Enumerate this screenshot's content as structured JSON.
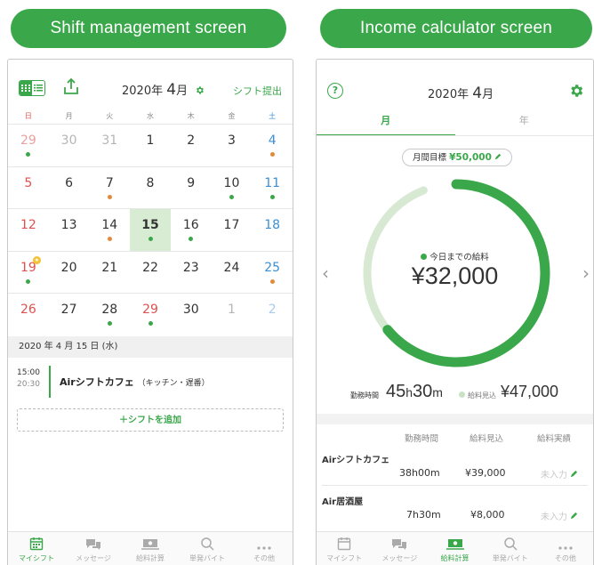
{
  "pills": {
    "left": "Shift management screen",
    "right": "Income calculator screen"
  },
  "shift_screen": {
    "year": "2020",
    "year_suffix": "年",
    "month": "4",
    "month_suffix": "月",
    "submit_label": "シフト提出",
    "weekdays": [
      "日",
      "月",
      "火",
      "水",
      "木",
      "金",
      "土"
    ],
    "weeks": [
      [
        {
          "d": "29",
          "t": "sun other",
          "dot": "g"
        },
        {
          "d": "30",
          "t": "other"
        },
        {
          "d": "31",
          "t": "other"
        },
        {
          "d": "1"
        },
        {
          "d": "2"
        },
        {
          "d": "3"
        },
        {
          "d": "4",
          "t": "sat",
          "dot": "o"
        }
      ],
      [
        {
          "d": "5",
          "t": "sun"
        },
        {
          "d": "6"
        },
        {
          "d": "7",
          "dot": "o"
        },
        {
          "d": "8"
        },
        {
          "d": "9"
        },
        {
          "d": "10",
          "dot": "g"
        },
        {
          "d": "11",
          "t": "sat",
          "dot": "g"
        }
      ],
      [
        {
          "d": "12",
          "t": "sun"
        },
        {
          "d": "13"
        },
        {
          "d": "14",
          "dot": "o"
        },
        {
          "d": "15",
          "t": "sel",
          "dot": "g"
        },
        {
          "d": "16",
          "dot": "g"
        },
        {
          "d": "17"
        },
        {
          "d": "18",
          "t": "sat"
        }
      ],
      [
        {
          "d": "19",
          "t": "sun",
          "dot": "g",
          "star": true
        },
        {
          "d": "20"
        },
        {
          "d": "21"
        },
        {
          "d": "22"
        },
        {
          "d": "23"
        },
        {
          "d": "24"
        },
        {
          "d": "25",
          "t": "sat",
          "dot": "o"
        }
      ],
      [
        {
          "d": "26",
          "t": "sun"
        },
        {
          "d": "27"
        },
        {
          "d": "28",
          "dot": "g"
        },
        {
          "d": "29",
          "t": "sun",
          "dot": "g"
        },
        {
          "d": "30"
        },
        {
          "d": "1",
          "t": "other"
        },
        {
          "d": "2",
          "t": "sat other"
        }
      ]
    ],
    "selected_date_label": "2020 年 4 月 15 日 (水)",
    "shift": {
      "start": "15:00",
      "end": "20:30",
      "name": "Airシフトカフェ",
      "detail": "（キッチン・遅番）"
    },
    "add_shift_label": "＋シフトを追加"
  },
  "income_screen": {
    "year": "2020",
    "year_suffix": "年",
    "month": "4",
    "month_suffix": "月",
    "help_label": "?",
    "tabs": [
      "月",
      "年"
    ],
    "goal_label": "月間目標",
    "goal_amount": "¥50,000",
    "ring_label": "今日までの給料",
    "ring_value": "¥32,000",
    "ring_progress": 0.64,
    "ring_projection": 0.94,
    "hours_label": "勤務時間",
    "hours_h": "45",
    "hours_m": "30",
    "projected_label": "給料見込",
    "projected_value": "¥47,000",
    "table_headers": [
      "勤務時間",
      "給料見込",
      "給料実績"
    ],
    "rows": [
      {
        "name": "Airシフトカフェ",
        "hours": "38h00m",
        "projected": "¥39,000",
        "actual": "未入力"
      },
      {
        "name": "Air居酒屋",
        "hours": "7h30m",
        "projected": "¥8,000",
        "actual": "未入力"
      }
    ]
  },
  "tabbar": [
    "マイシフト",
    "メッセージ",
    "給料計算",
    "単発バイト",
    "その他"
  ],
  "colors": {
    "brand": "#3aa84a",
    "sunday": "#e05050",
    "saturday": "#3a8fd6",
    "shift_dot_green": "#3aa84a",
    "shift_dot_orange": "#e08a3a",
    "selected_day_bg": "#d8ecd4"
  }
}
